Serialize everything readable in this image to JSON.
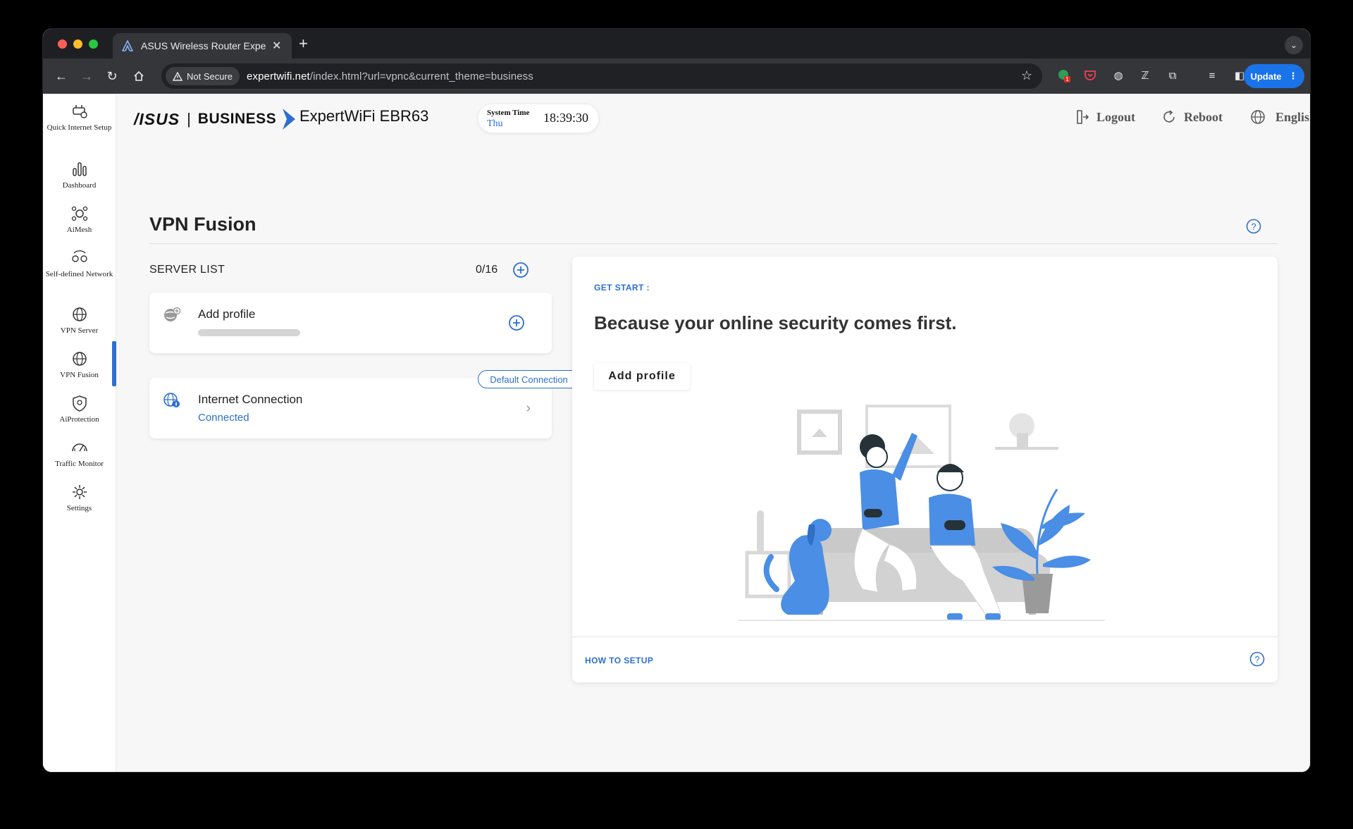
{
  "browser": {
    "tab_title": "ASUS Wireless Router Exper",
    "new_tab": "+",
    "not_secure": "Not Secure",
    "url_host": "expertwifi.net",
    "url_path": "/index.html?url=vpnc&current_theme=business",
    "update_label": "Update",
    "extension_badge": "1"
  },
  "sidebar": {
    "items": [
      {
        "label": "Quick Internet Setup"
      },
      {
        "label": "Dashboard"
      },
      {
        "label": "AiMesh"
      },
      {
        "label": "Self-defined Network"
      },
      {
        "label": "VPN Server"
      },
      {
        "label": "VPN Fusion"
      },
      {
        "label": "AiProtection"
      },
      {
        "label": "Traffic Monitor"
      },
      {
        "label": "Settings"
      }
    ]
  },
  "header": {
    "logo_asus": "/ISUS",
    "logo_sep": "|",
    "logo_business": "BUSINESS",
    "model": "ExpertWiFi EBR63",
    "system_time_label": "System Time",
    "system_day": "Thu",
    "system_clock": "18:39:30",
    "logout": "Logout",
    "reboot": "Reboot",
    "language": "English"
  },
  "main": {
    "title": "VPN Fusion",
    "server_list_label": "SERVER LIST",
    "server_count": "0/16",
    "add_profile_card": "Add profile",
    "internet_card_title": "Internet Connection",
    "internet_card_status": "Connected",
    "default_badge": "Default Connection"
  },
  "panel": {
    "get_start": "GET START :",
    "headline": "Because your online security comes first.",
    "add_profile_button": "Add profile",
    "how_to_setup": "HOW TO SETUP"
  },
  "colors": {
    "accent": "#2c6fd1",
    "illustration_blue": "#4a8ee6"
  }
}
